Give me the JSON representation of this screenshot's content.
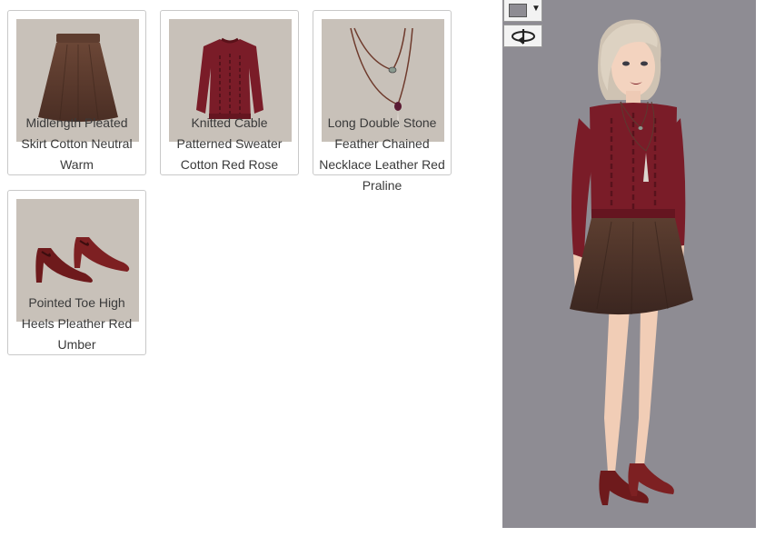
{
  "items": [
    {
      "name": "Midlength Pleated Skirt Cotton Neutral Warm",
      "icon": "skirt-icon"
    },
    {
      "name": "Knitted Cable Patterned Sweater Cotton Red Rose",
      "icon": "sweater-icon"
    },
    {
      "name": "Long Double Stone Feather Chained Necklace Leather Red Praline",
      "icon": "necklace-icon"
    },
    {
      "name": "Pointed Toe High Heels Pleather Red Umber",
      "icon": "heels-icon"
    }
  ],
  "preview": {
    "background_color": "#8e8c93",
    "swatch_color": "#8e8c93",
    "color_picker_icon": "caret-down-icon",
    "rotate_icon": "rotate-icon"
  },
  "colors": {
    "thumb_bg": "#c8c1b9",
    "skirt": "#5a3b2e",
    "sweater": "#7a1c28",
    "heels": "#6e1a1c"
  }
}
